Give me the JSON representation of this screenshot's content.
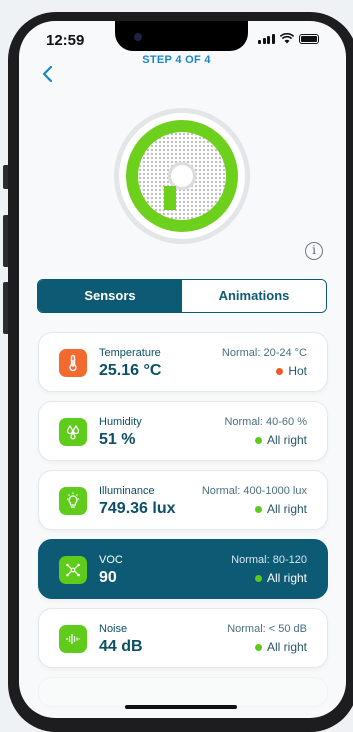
{
  "status_bar": {
    "time": "12:59"
  },
  "header": {
    "step": "STEP 4 OF 4"
  },
  "tabs": [
    {
      "label": "Sensors",
      "active": true
    },
    {
      "label": "Animations",
      "active": false
    }
  ],
  "sensors": [
    {
      "name": "Temperature",
      "value": "25.16 °C",
      "normal": "Normal: 20-24 °C",
      "status": "Hot",
      "status_color": "#f05a2a",
      "icon_bg": "#f26a2e",
      "icon": "thermometer-icon"
    },
    {
      "name": "Humidity",
      "value": "51 %",
      "normal": "Normal: 40-60 %",
      "status": "All right",
      "status_color": "#5ccb1f",
      "icon_bg": "#5fcc1c",
      "icon": "droplets-icon"
    },
    {
      "name": "Illuminance",
      "value": "749.36 lux",
      "normal": "Normal: 400-1000 lux",
      "status": "All right",
      "status_color": "#5ccb1f",
      "icon_bg": "#5fcc1c",
      "icon": "lightbulb-icon"
    },
    {
      "name": "VOC",
      "value": "90",
      "normal": "Normal: 80-120",
      "status": "All right",
      "status_color": "#5ccb1f",
      "icon_bg": "#5fcc1c",
      "icon": "molecule-icon",
      "active": true
    },
    {
      "name": "Noise",
      "value": "44 dB",
      "normal": "Normal: < 50 dB",
      "status": "All right",
      "status_color": "#5ccb1f",
      "icon_bg": "#5fcc1c",
      "icon": "soundwave-icon"
    }
  ],
  "colors": {
    "accent": "#0c5a74",
    "link": "#1a86c6",
    "ring": "#6cd01c"
  }
}
